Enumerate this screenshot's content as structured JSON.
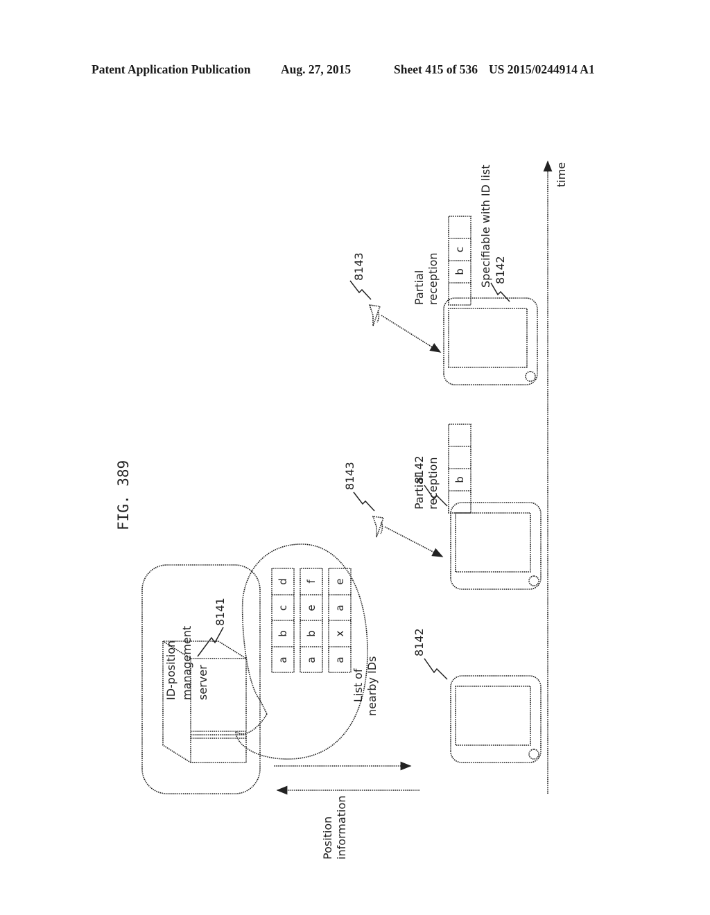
{
  "header": {
    "publication": "Patent Application Publication",
    "date": "Aug. 27, 2015",
    "sheet": "Sheet 415 of 536",
    "number": "US 2015/0244914 A1"
  },
  "figure": {
    "title": "FIG. 389",
    "server": {
      "label_lines": [
        "ID-position",
        "management",
        "server"
      ],
      "ref": "8141"
    },
    "id_list": {
      "rows": [
        [
          "a",
          "b",
          "c",
          "d"
        ],
        [
          "a",
          "b",
          "e",
          "f"
        ],
        [
          "a",
          "x",
          "a",
          "e"
        ]
      ],
      "caption_lines": [
        "List of",
        "nearby IDs"
      ]
    },
    "position_info_lines": [
      "Position",
      "information"
    ],
    "stages": [
      {
        "phone_ref": "8142"
      },
      {
        "phone_ref": "8142",
        "transmitter_ref": "8143",
        "reception_lines": [
          "Partial",
          "reception"
        ],
        "received_cells": [
          "",
          "b",
          "",
          ""
        ]
      },
      {
        "phone_ref": "8142",
        "transmitter_ref": "8143",
        "reception_lines": [
          "Partial",
          "reception"
        ],
        "received_cells": [
          "",
          "b",
          "c",
          ""
        ],
        "result": "Specifiable with ID list"
      }
    ],
    "time_axis_label": "time"
  }
}
